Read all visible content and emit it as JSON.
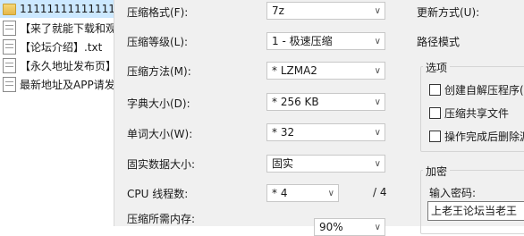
{
  "explorer": {
    "files": [
      {
        "name": "11111111111111",
        "type": "folder"
      },
      {
        "name": "【来了就能下载和观",
        "type": "text"
      },
      {
        "name": "【论坛介绍】.txt",
        "type": "text"
      },
      {
        "name": "【永久地址发布页】",
        "type": "text"
      },
      {
        "name": "最新地址及APP请发",
        "type": "text"
      }
    ]
  },
  "dialog": {
    "archive_format": {
      "label": "压缩格式(F):",
      "value": "7z"
    },
    "compression_level": {
      "label": "压缩等级(L):",
      "value": "1 - 极速压缩"
    },
    "compression_method": {
      "label": "压缩方法(M):",
      "value": "* LZMA2"
    },
    "dictionary_size": {
      "label": "字典大小(D):",
      "value": "* 256 KB"
    },
    "word_size": {
      "label": "单词大小(W):",
      "value": "* 32"
    },
    "solid_block_size": {
      "label": "固实数据大小:",
      "value": "固实"
    },
    "cpu_threads": {
      "label": "CPU 线程数:",
      "value": "* 4",
      "total": "/ 4"
    },
    "memory_usage": {
      "label": "压缩所需内存:",
      "value": "90%"
    },
    "update_mode": {
      "label": "更新方式(U):"
    },
    "path_mode": {
      "label": "路径模式"
    },
    "options": {
      "title": "选项",
      "sfx": "创建自解压程序(X",
      "shared": "压缩共享文件",
      "delete_after": "操作完成后删除源"
    },
    "encryption": {
      "title": "加密",
      "password_label": "输入密码:",
      "password_value": "上老王论坛当老王"
    }
  }
}
